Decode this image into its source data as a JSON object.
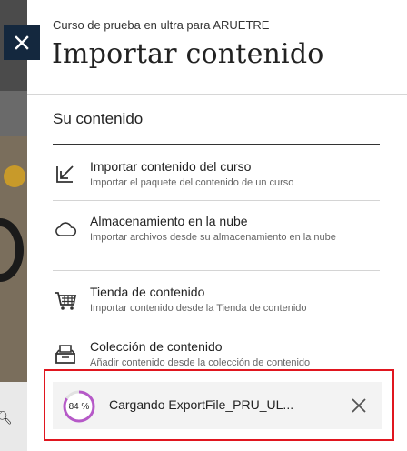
{
  "panel": {
    "course_name": "Curso de prueba en ultra para ARUETRE",
    "title": "Importar contenido",
    "close_icon": "close-icon"
  },
  "section": {
    "title": "Su contenido"
  },
  "items": [
    {
      "icon": "import-arrow-icon",
      "label": "Importar contenido del curso",
      "description": "Importar el paquete del contenido de un curso"
    },
    {
      "icon": "cloud-icon",
      "label": "Almacenamiento en la nube",
      "description": "Importar archivos desde su almacenamiento en la nube"
    },
    {
      "icon": "cart-icon",
      "label": "Tienda de contenido",
      "description": "Importar contenido desde la Tienda de contenido"
    },
    {
      "icon": "tray-icon",
      "label": "Colección de contenido",
      "description": "Añadir contenido desde la colección de contenido"
    }
  ],
  "upload": {
    "progress_label": "84 %",
    "progress_value": 0.84,
    "text": "Cargando ExportFile_PRU_UL...",
    "cancel_icon": "close-icon",
    "ring_color": "#b659c8",
    "highlight_color": "#e0161f"
  }
}
